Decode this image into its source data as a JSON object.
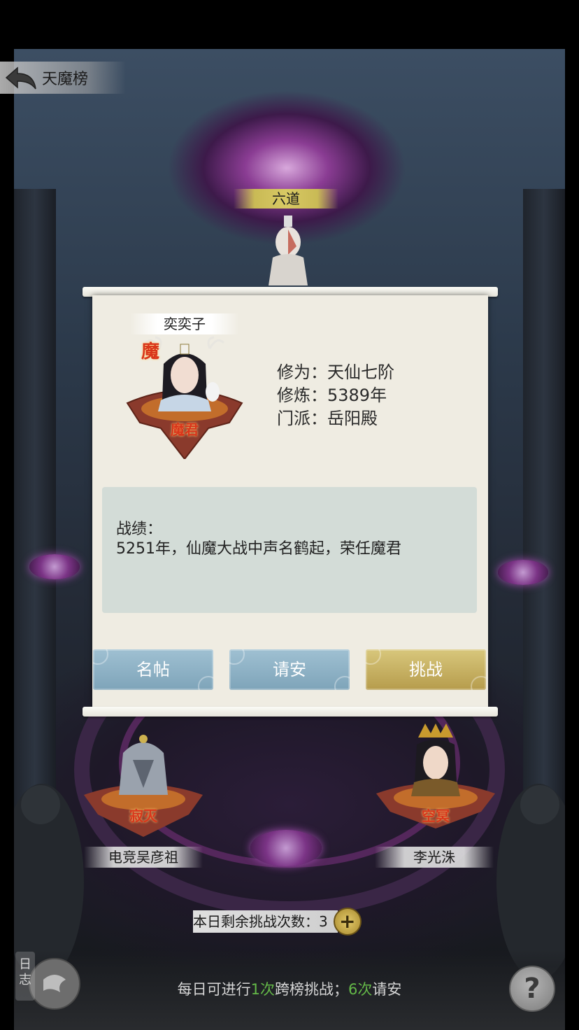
{
  "header": {
    "title": "天魔榜"
  },
  "top_rank": {
    "label": "六道"
  },
  "dialog": {
    "player_name": "奕奕子",
    "badge_top": "魔",
    "badge_title": "魔君",
    "stats": {
      "cultivation": "修为：天仙七阶",
      "practice": "修炼：5389年",
      "sect": "门派：岳阳殿"
    },
    "record": {
      "title": "战绩：",
      "text": "5251年，仙魔大战中声名鹤起，荣任魔君"
    },
    "buttons": {
      "card": "名帖",
      "greet": "请安",
      "challenge": "挑战"
    }
  },
  "ranks": [
    {
      "name": "电竞吴彦祖",
      "title": "寂灭"
    },
    {
      "name": "李光洙",
      "title": "空冥"
    }
  ],
  "remaining": {
    "label": "本日剩余挑战次数：3",
    "add_icon": "plus-icon"
  },
  "daily": {
    "part1": "每日可进行",
    "count1": "1次",
    "part2": "跨榜挑战；",
    "count2": "6次",
    "part3": "请安"
  },
  "log": {
    "label": "日志"
  },
  "help": {
    "label": "?"
  },
  "colors": {
    "gold": "#c9ba55",
    "blue_button": "#8eb2c6",
    "gold_button": "#c8b464",
    "highlight_green": "#64b948",
    "scroll": "#efece2"
  }
}
